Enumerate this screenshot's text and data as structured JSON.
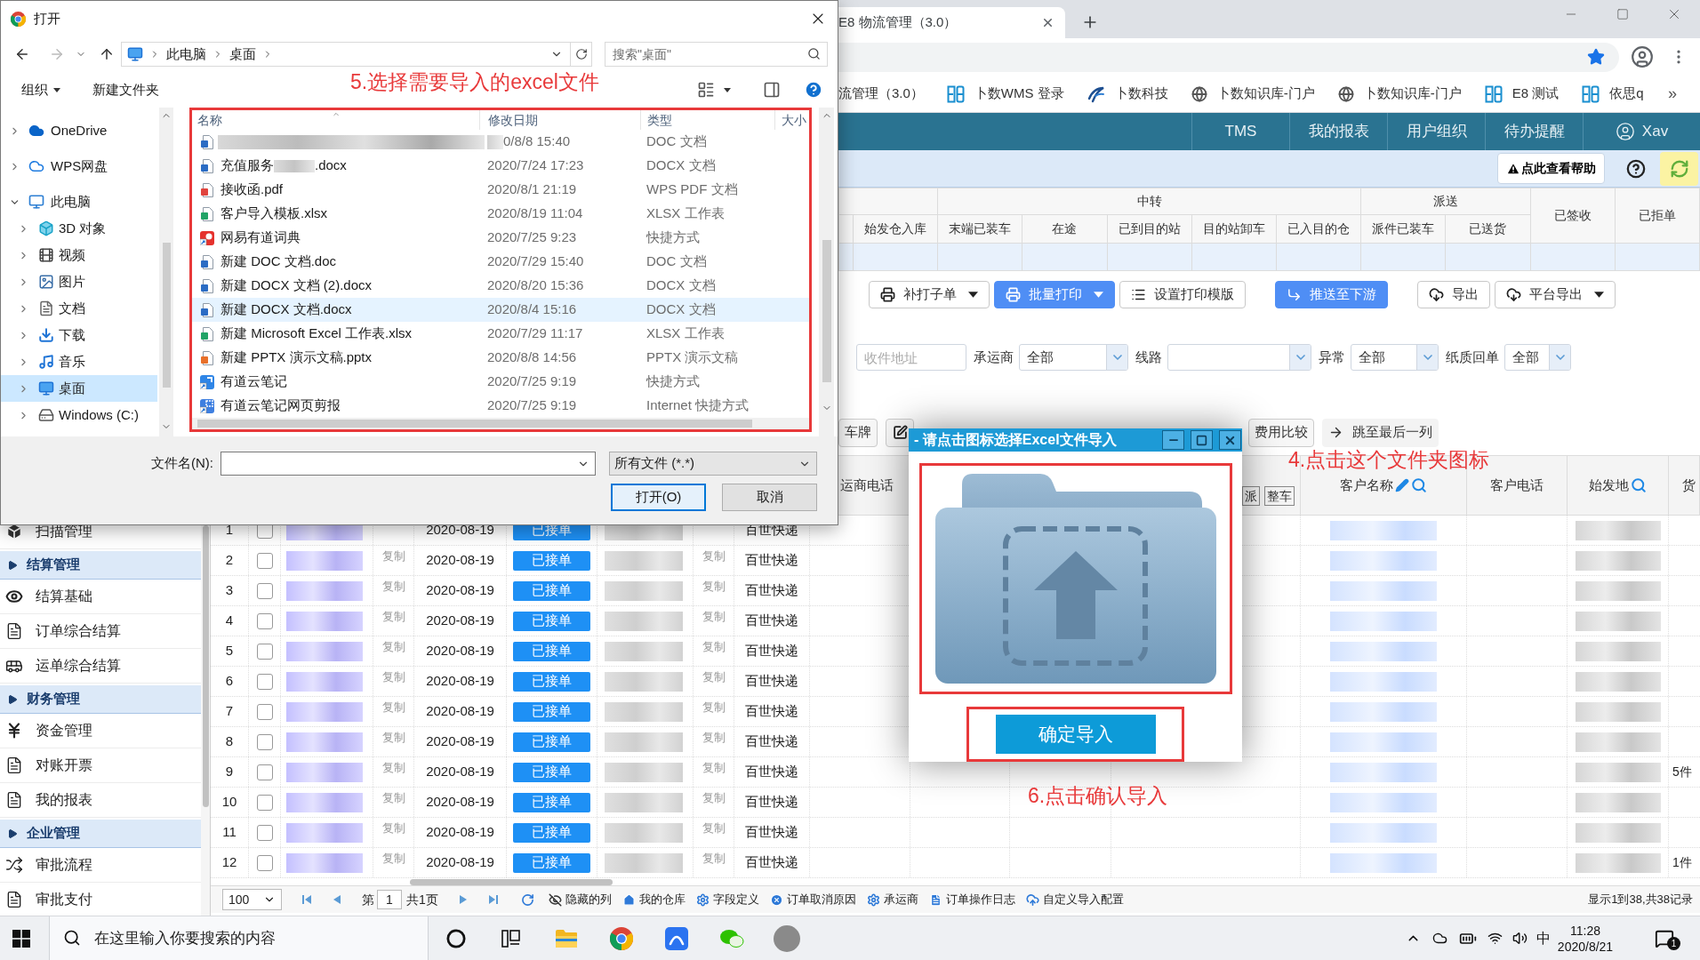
{
  "browser": {
    "tab": {
      "title": "E8 物流管理（3.0）"
    },
    "bookmarks": [
      {
        "kind": "plain",
        "label": "流管理（3.0）"
      },
      {
        "kind": "tile",
        "label": "卜数WMS 登录"
      },
      {
        "kind": "swoosh",
        "label": "卜数科技"
      },
      {
        "kind": "globe",
        "label": "卜数知识库-门户"
      },
      {
        "kind": "globe",
        "label": "卜数知识库-门户"
      },
      {
        "kind": "tile",
        "label": "E8 测试"
      },
      {
        "kind": "tile",
        "label": "依思q"
      }
    ],
    "bookmark_overflow": "»"
  },
  "app": {
    "nav": [
      {
        "label": "TMS"
      },
      {
        "label": "我的报表"
      },
      {
        "label": "用户组织"
      },
      {
        "label": "待办提醒"
      }
    ],
    "user": "Xav",
    "help": "点此查看帮助",
    "sidebar": [
      {
        "kind": "cube",
        "label": "扫描管理"
      },
      {
        "kind": "section",
        "label": "结算管理"
      },
      {
        "kind": "eye",
        "label": "结算基础"
      },
      {
        "kind": "doc",
        "label": "订单综合结算"
      },
      {
        "kind": "bus",
        "label": "运单综合结算"
      },
      {
        "kind": "section",
        "label": "财务管理"
      },
      {
        "kind": "yen",
        "label": "资金管理"
      },
      {
        "kind": "doc",
        "label": "对账开票"
      },
      {
        "kind": "doc",
        "label": "我的报表"
      },
      {
        "kind": "section",
        "label": "企业管理"
      },
      {
        "kind": "shuffle",
        "label": "审批流程"
      },
      {
        "kind": "doc",
        "label": "审批支付"
      }
    ],
    "summary": {
      "groups": [
        {
          "columns": [
            "始发仓入库"
          ]
        },
        {
          "label": "中转",
          "columns": [
            "末端已装车",
            "在途",
            "已到目的站",
            "目的站卸车",
            "已入目的仓"
          ]
        },
        {
          "label": "派送",
          "columns": [
            "派件已装车",
            "已送货"
          ]
        },
        {
          "label": "已签收"
        },
        {
          "label": "已拒单"
        }
      ]
    },
    "toolbar": [
      [
        {
          "kind": "printer",
          "label": "补打子单",
          "dropdown": true,
          "primary": false
        },
        {
          "kind": "printer",
          "label": "批量打印",
          "dropdown": true,
          "primary": true
        },
        {
          "kind": "list",
          "label": "设置打印模版",
          "dropdown": false,
          "primary": false
        }
      ],
      [
        {
          "kind": "forward",
          "label": "推送至下游",
          "dropdown": false,
          "primary": true
        }
      ],
      [
        {
          "kind": "cloud",
          "label": "导出",
          "dropdown": false,
          "primary": false
        },
        {
          "kind": "cloud",
          "label": "平台导出",
          "dropdown": true,
          "primary": false
        }
      ]
    ],
    "filters": [
      {
        "kind": "input",
        "placeholder": "收件地址"
      },
      {
        "kind": "select",
        "label": "承运商",
        "value": "全部"
      },
      {
        "kind": "select",
        "label": "线路"
      },
      {
        "kind": "select",
        "label": "异常",
        "value": "全部"
      },
      {
        "kind": "select",
        "label": "纸质回单",
        "value": "全部"
      }
    ],
    "actions": [
      {
        "kind": "plain",
        "label": "车牌"
      },
      {
        "kind": "edit"
      },
      {
        "kind": "plain",
        "label": "费用比较"
      },
      {
        "kind": "arrow",
        "label": "跳至最后一列"
      }
    ],
    "grid": {
      "pixelated": true,
      "columns": [
        {
          "kind": "plain",
          "label": "运商电话"
        },
        {
          "kind": "tags",
          "tags": [
            "派",
            "整车"
          ]
        },
        {
          "kind": "editable",
          "label": "客户名称"
        },
        {
          "kind": "plain",
          "label": "客户电话"
        },
        {
          "kind": "searchable",
          "label": "始发地"
        },
        {
          "kind": "plain",
          "label": "货"
        }
      ],
      "rows": [
        {
          "no": "1",
          "checked": false,
          "date": "2020-08-19",
          "status": "已接单",
          "carrier": "百世快递"
        },
        {
          "no": "2",
          "checked": false,
          "copy_order": "复制",
          "date": "2020-08-19",
          "status": "已接单",
          "copy_phone": "复制",
          "carrier": "百世快递"
        },
        {
          "no": "3",
          "checked": false,
          "copy_order": "复制",
          "date": "2020-08-19",
          "status": "已接单",
          "copy_phone": "复制",
          "carrier": "百世快递"
        },
        {
          "no": "4",
          "checked": false,
          "copy_order": "复制",
          "date": "2020-08-19",
          "status": "已接单",
          "copy_phone": "复制",
          "carrier": "百世快递"
        },
        {
          "no": "5",
          "checked": false,
          "copy_order": "复制",
          "date": "2020-08-19",
          "status": "已接单",
          "copy_phone": "复制",
          "carrier": "百世快递"
        },
        {
          "no": "6",
          "checked": false,
          "copy_order": "复制",
          "date": "2020-08-19",
          "status": "已接单",
          "copy_phone": "复制",
          "carrier": "百世快递"
        },
        {
          "no": "7",
          "checked": false,
          "copy_order": "复制",
          "date": "2020-08-19",
          "status": "已接单",
          "copy_phone": "复制",
          "carrier": "百世快递"
        },
        {
          "no": "8",
          "checked": false,
          "copy_order": "复制",
          "date": "2020-08-19",
          "status": "已接单",
          "copy_phone": "复制",
          "carrier": "百世快递"
        },
        {
          "no": "9",
          "checked": false,
          "copy_order": "复制",
          "date": "2020-08-19",
          "status": "已接单",
          "copy_phone": "复制",
          "carrier": "百世快递",
          "pieces": "5件"
        },
        {
          "no": "10",
          "checked": false,
          "copy_order": "复制",
          "date": "2020-08-19",
          "status": "已接单",
          "copy_phone": "复制",
          "carrier": "百世快递"
        },
        {
          "no": "11",
          "checked": false,
          "copy_order": "复制",
          "date": "2020-08-19",
          "status": "已接单",
          "copy_phone": "复制",
          "carrier": "百世快递"
        },
        {
          "no": "12",
          "checked": false,
          "copy_order": "复制",
          "date": "2020-08-19",
          "status": "已接单",
          "copy_phone": "复制",
          "carrier": "百世快递",
          "pieces": "1件"
        }
      ]
    },
    "pager": {
      "page_size": "100",
      "page_prefix": "第",
      "page": "1",
      "page_total": "共1页",
      "links": [
        {
          "kind": "hidden",
          "label": "隐藏的列"
        },
        {
          "kind": "home",
          "label": "我的仓库"
        },
        {
          "kind": "gear",
          "label": "字段定义"
        },
        {
          "kind": "cancel",
          "label": "订单取消原因"
        },
        {
          "kind": "gear",
          "label": "承运商"
        },
        {
          "kind": "log",
          "label": "订单操作日志"
        },
        {
          "kind": "cloud",
          "label": "自定义导入配置"
        }
      ],
      "summary": "显示1到38,共38记录"
    }
  },
  "file_dialog": {
    "title": "打开",
    "path": [
      "此电脑",
      "桌面"
    ],
    "search": {
      "placeholder": "搜索\"桌面\""
    },
    "commands": [
      {
        "label": "组织",
        "dropdown": true
      },
      {
        "label": "新建文件夹",
        "dropdown": false
      }
    ],
    "annotation": "5.选择需要导入的excel文件",
    "highlighted": true,
    "tree": [
      {
        "kind": "cloud",
        "label": "OneDrive",
        "expanded": false,
        "selected": false
      },
      {
        "kind": "cloudoutline",
        "label": "WPS网盘",
        "expanded": false,
        "selected": false
      },
      {
        "kind": "computer",
        "label": "此电脑",
        "expanded": true,
        "selected": false,
        "children": [
          {
            "kind": "cube",
            "label": "3D 对象",
            "expanded": false,
            "selected": false
          },
          {
            "kind": "film",
            "label": "视频",
            "expanded": false,
            "selected": false
          },
          {
            "kind": "picture",
            "label": "图片",
            "expanded": false,
            "selected": false
          },
          {
            "kind": "document",
            "label": "文档",
            "expanded": false,
            "selected": false
          },
          {
            "kind": "download",
            "label": "下载",
            "expanded": false,
            "selected": false
          },
          {
            "kind": "music",
            "label": "音乐",
            "expanded": false,
            "selected": false
          },
          {
            "kind": "desktop",
            "label": "桌面",
            "expanded": false,
            "selected": true
          },
          {
            "kind": "drive",
            "label": "Windows (C:)",
            "expanded": false,
            "selected": false
          }
        ]
      }
    ],
    "columns": [
      "名称",
      "修改日期",
      "类型",
      "大小"
    ],
    "files": [
      {
        "kind": "word",
        "modified": "0/8/8 15:40",
        "type": "DOC 文档",
        "selected": false,
        "pixelated": true
      },
      {
        "kind": "word",
        "name": "充值服务",
        "name_tail": ".docx",
        "modified": "2020/7/24 17:23",
        "type": "DOCX 文档",
        "selected": false,
        "pixelated": true
      },
      {
        "kind": "pdf",
        "name": "接收函.pdf",
        "modified": "2020/8/1 21:19",
        "type": "WPS PDF 文档",
        "selected": false,
        "pixelated": false
      },
      {
        "kind": "excel",
        "name": "客户导入模板.xlsx",
        "modified": "2020/8/19 11:04",
        "type": "XLSX 工作表",
        "selected": false,
        "pixelated": false
      },
      {
        "kind": "dict",
        "name": "网易有道词典",
        "modified": "2020/7/25 9:23",
        "type": "快捷方式",
        "selected": false,
        "pixelated": false
      },
      {
        "kind": "word",
        "name": "新建 DOC 文档.doc",
        "modified": "2020/7/29 15:40",
        "type": "DOC 文档",
        "selected": false,
        "pixelated": false
      },
      {
        "kind": "word",
        "name": "新建 DOCX 文档 (2).docx",
        "modified": "2020/8/20 15:36",
        "type": "DOCX 文档",
        "selected": false,
        "pixelated": false
      },
      {
        "kind": "word",
        "name": "新建 DOCX 文档.docx",
        "modified": "2020/8/4 15:16",
        "type": "DOCX 文档",
        "selected": true,
        "pixelated": false
      },
      {
        "kind": "excel",
        "name": "新建 Microsoft Excel 工作表.xlsx",
        "modified": "2020/7/29 11:17",
        "type": "XLSX 工作表",
        "selected": false,
        "pixelated": false
      },
      {
        "kind": "ppt",
        "name": "新建 PPTX 演示文稿.pptx",
        "modified": "2020/8/8 14:56",
        "type": "PPTX 演示文稿",
        "selected": false,
        "pixelated": false
      },
      {
        "kind": "note",
        "name": "有道云笔记",
        "modified": "2020/7/25 9:19",
        "type": "快捷方式",
        "selected": false,
        "pixelated": false
      },
      {
        "kind": "clip",
        "name": "有道云笔记网页剪报",
        "modified": "2020/7/25 9:19",
        "type": "Internet 快捷方式",
        "selected": false,
        "pixelated": false
      }
    ],
    "file_name_label": "文件名(N):",
    "file_type": "所有文件 (*.*)",
    "buttons": [
      {
        "label": "打开(O)",
        "default": true
      },
      {
        "label": "取消",
        "default": false
      }
    ]
  },
  "import_dialog": {
    "title": "- 请点击图标选择Excel文件导入",
    "folder_highlighted": true,
    "folder_annotation": "4.点击这个文件夹图标",
    "confirm": {
      "label": "确定导入",
      "highlighted": true
    },
    "confirm_annotation": "6.点击确认导入"
  },
  "taskbar": {
    "search_placeholder": "在这里输入你要搜索的内容",
    "apps": [
      {
        "kind": "ring"
      },
      {
        "kind": "taskview"
      },
      {
        "kind": "folder"
      },
      {
        "kind": "roundlogo"
      },
      {
        "kind": "bluetile"
      },
      {
        "kind": "chat"
      },
      {
        "kind": "avatar"
      }
    ],
    "tray": [
      {
        "kind": "chevron"
      },
      {
        "kind": "cloud"
      },
      {
        "kind": "battery"
      },
      {
        "kind": "wifi"
      },
      {
        "kind": "volume"
      }
    ],
    "ime": "中",
    "time": "11:28",
    "date": "2020/8/21",
    "notifications": "1"
  }
}
